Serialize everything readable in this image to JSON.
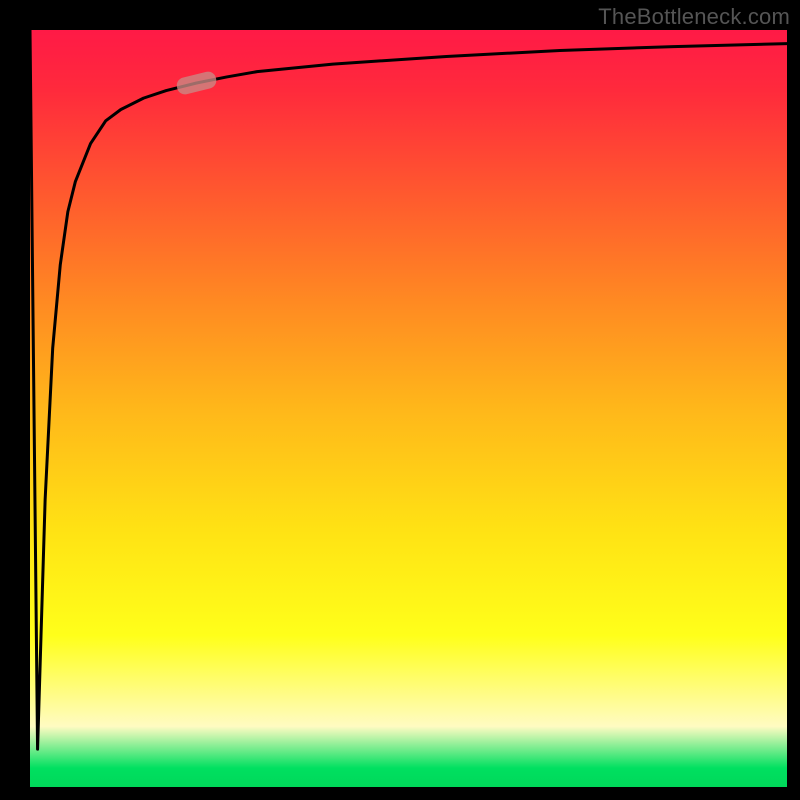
{
  "watermark": "TheBottleneck.com",
  "colors": {
    "background": "#000000",
    "gradient_top": "#ff1a46",
    "gradient_mid": "#ffe214",
    "gradient_bottom": "#00d85a",
    "curve": "#000000",
    "marker": "#c98b85"
  },
  "chart_data": {
    "type": "line",
    "title": "",
    "xlabel": "",
    "ylabel": "",
    "xlim": [
      0,
      100
    ],
    "ylim": [
      0,
      100
    ],
    "grid": false,
    "legend": false,
    "annotations": [
      "TheBottleneck.com"
    ],
    "series": [
      {
        "name": "bottleneck-curve",
        "x": [
          0,
          1,
          2,
          3,
          4,
          5,
          6,
          8,
          10,
          12,
          15,
          18,
          22,
          26,
          30,
          40,
          55,
          70,
          85,
          100
        ],
        "y": [
          100,
          5,
          38,
          58,
          69,
          76,
          80,
          85,
          88,
          89.5,
          91,
          92,
          93,
          93.8,
          94.5,
          95.5,
          96.5,
          97.3,
          97.8,
          98.2
        ]
      }
    ],
    "marker": {
      "x": 22,
      "y": 93,
      "label": ""
    }
  }
}
